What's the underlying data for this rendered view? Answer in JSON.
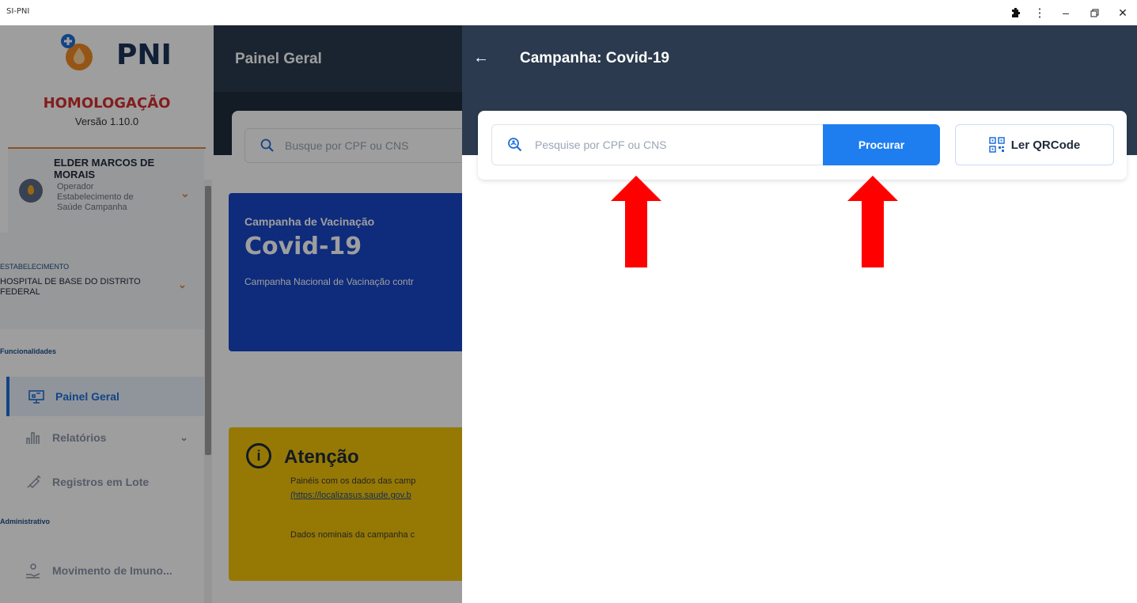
{
  "window": {
    "title": "SI-PNI"
  },
  "sidebar": {
    "logo_text": "PNI",
    "environment": "HOMOLOGAÇÃO",
    "version": "Versão 1.10.0",
    "user": {
      "name": "ELDER MARCOS DE MORAIS",
      "role": "Operador Estabelecimento de Saúde Campanha"
    },
    "establishment": {
      "label": "ESTABELECIMENTO",
      "name": "HOSPITAL DE BASE DO DISTRITO FEDERAL"
    },
    "sections": {
      "features": "Funcionalidades",
      "admin": "Administrativo"
    },
    "items": [
      {
        "label": "Painel Geral",
        "icon": "dashboard-icon",
        "active": true
      },
      {
        "label": "Relatórios",
        "icon": "reports-icon"
      },
      {
        "label": "Registros em Lote",
        "icon": "syringe-icon"
      },
      {
        "label": "Movimento de Imuno...",
        "icon": "hand-box-icon"
      }
    ]
  },
  "main": {
    "title": "Painel Geral",
    "search_placeholder": "Busque por CPF ou CNS",
    "campaign": {
      "subtitle": "Campanha de Vacinação",
      "title": "Covid-19",
      "description": "Campanha Nacional de Vacinação contr"
    },
    "attention": {
      "title": "Atenção",
      "text1": "Painéis com os dados das camp",
      "link": "(https://localizasus.saude.gov.b",
      "text2": "Dados nominais da campanha c"
    }
  },
  "panel": {
    "title": "Campanha: Covid-19",
    "search_placeholder": "Pesquise por CPF ou CNS",
    "search_button": "Procurar",
    "qr_button": "Ler QRCode"
  },
  "colors": {
    "header": "#2b3a4e",
    "primary_button": "#1e7ef0",
    "campaign_card": "#1746c9",
    "attention_card": "#f2c409",
    "arrows": "#ff0000",
    "environment": "#d32f2f"
  }
}
